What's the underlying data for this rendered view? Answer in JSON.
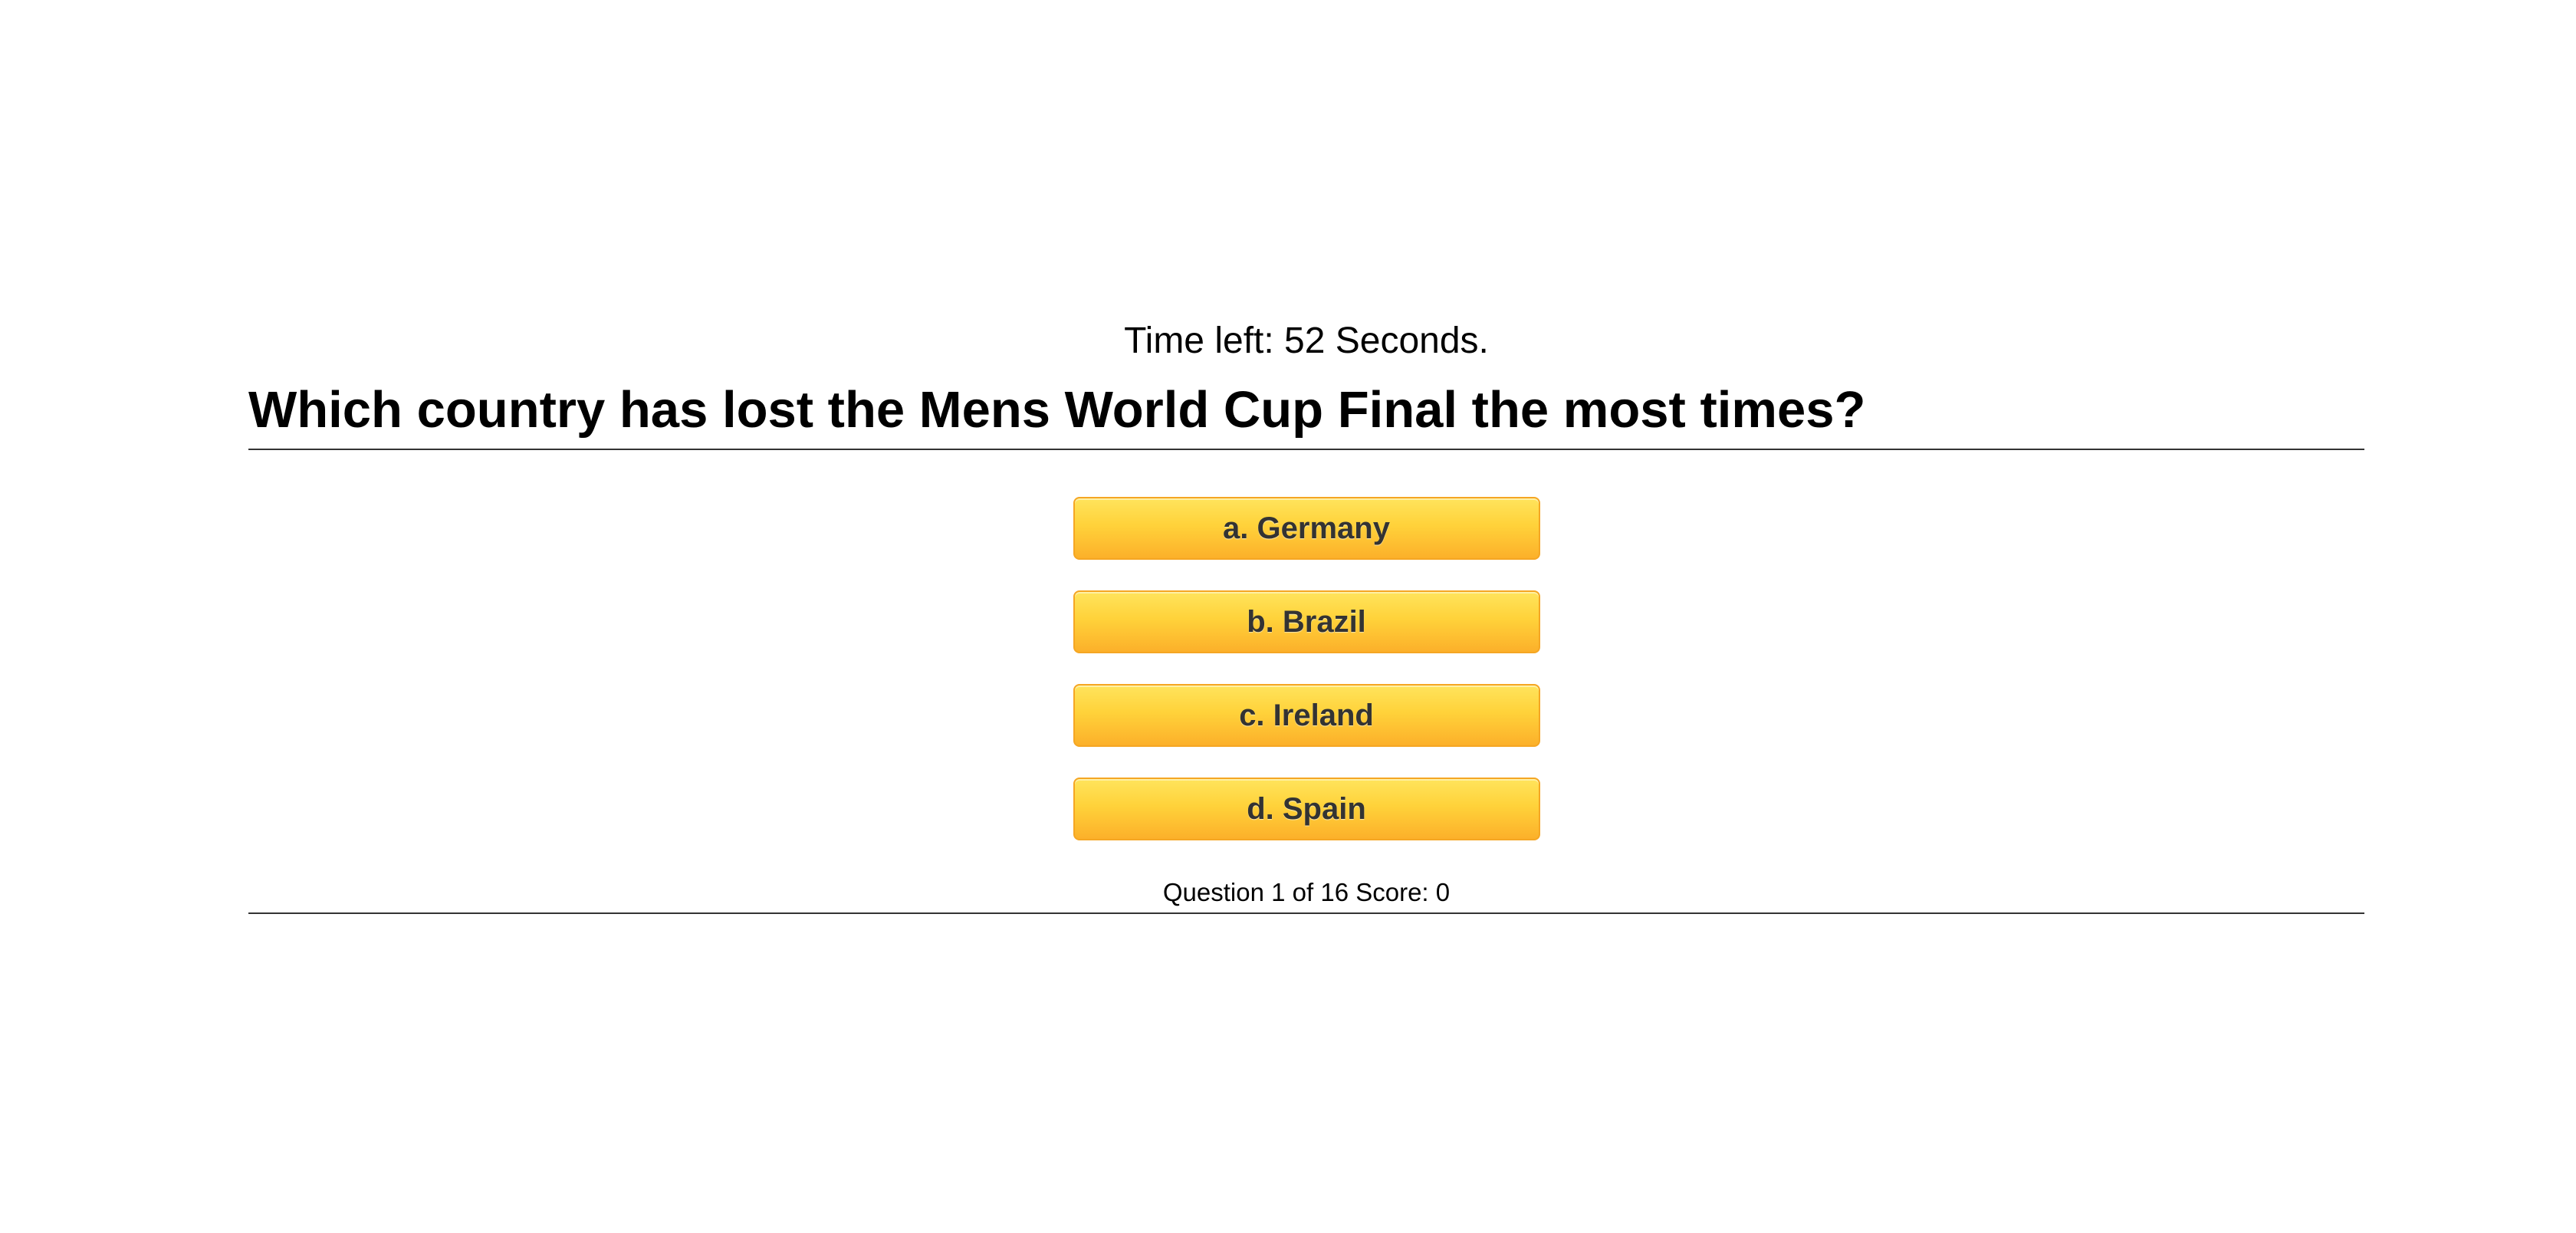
{
  "timer": {
    "prefix": "Time left:",
    "seconds": "52",
    "suffix": "Seconds.",
    "text": "Time left: 52 Seconds."
  },
  "question": {
    "text": "Which country has lost the Mens World Cup Final the most times?"
  },
  "answers": [
    {
      "letter": "a",
      "label": "a. Germany"
    },
    {
      "letter": "b",
      "label": "b. Brazil"
    },
    {
      "letter": "c",
      "label": "c. Ireland"
    },
    {
      "letter": "d",
      "label": "d. Spain"
    }
  ],
  "status": {
    "current_question": 1,
    "total_questions": 16,
    "score": 0,
    "text": "Question 1 of 16 Score: 0"
  },
  "colors": {
    "button_top": "#ffe45c",
    "button_bottom": "#fcb02a",
    "button_border": "#f5a623",
    "button_text": "#333333",
    "rule": "#333333"
  }
}
